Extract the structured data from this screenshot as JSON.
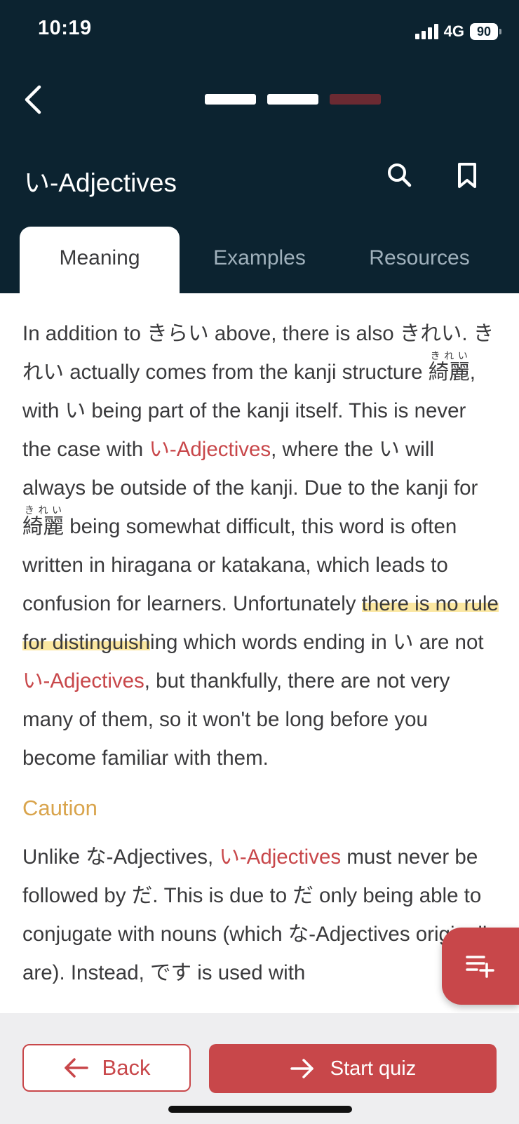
{
  "status": {
    "time": "10:19",
    "network": "4G",
    "battery": "90"
  },
  "header": {
    "title": "い-Adjectives",
    "progress_colors": [
      "#ffffff",
      "#ffffff",
      "#6b2a32"
    ]
  },
  "tabs": [
    {
      "label": "Meaning",
      "active": true
    },
    {
      "label": "Examples",
      "active": false
    },
    {
      "label": "Resources",
      "active": false
    }
  ],
  "content": {
    "p1": [
      "In addition to きらい above, there is also きれい. きれい actually comes from the kanji structure ",
      "綺麗",
      "きれい",
      ", with い being part of the kanji itself. This is never the case with ",
      "い-Adjectives",
      ", where the い will always be outside of the kanji. Due to the kanji for ",
      "綺麗",
      "きれい",
      " being somewhat difficult, this word is often written in hiragana or katakana, which leads to confusion for learners. Unfortunately ",
      "there is no rule for distinguish",
      "ing which words ending in い are not ",
      "い-Adjectives",
      ", but thankfully, there are not very many of them, so it won't be long before you become familiar with them."
    ],
    "caution_title": "Caution",
    "p2": [
      "Unlike な-Adjectives, ",
      "い-Adjectives",
      " must never be followed by だ. This is due to だ only being able to conjugate with nouns (which な-Adjectives originally are). Instead, です is used with"
    ]
  },
  "buttons": {
    "back": "Back",
    "start_quiz": "Start quiz"
  },
  "icons": {
    "back": "chevron-left-icon",
    "search": "search-icon",
    "bookmark": "bookmark-icon",
    "fab": "playlist-add-icon"
  },
  "colors": {
    "header_bg": "#0c2330",
    "accent": "#c8474a",
    "caution": "#d9a44c",
    "highlight": "#fbe7a1"
  }
}
